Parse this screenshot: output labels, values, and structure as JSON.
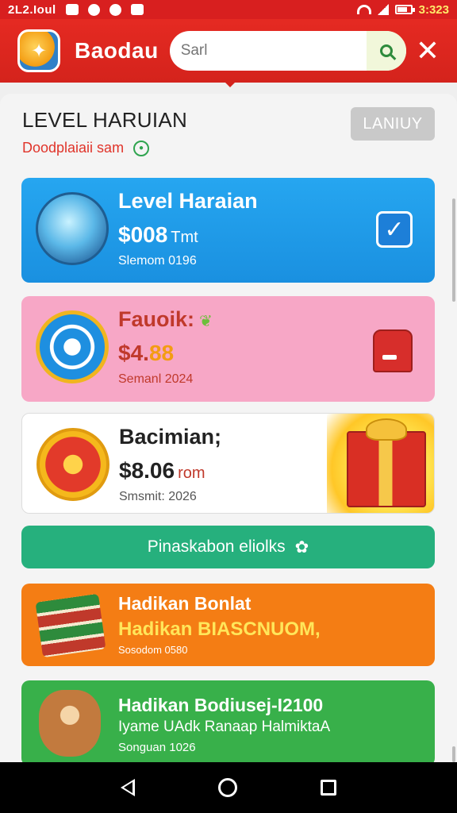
{
  "status_bar": {
    "left_text": "2L2.Ioul",
    "time": "3:323"
  },
  "app_bar": {
    "title": "Baodau",
    "search_placeholder": "Sarl"
  },
  "header": {
    "title": "LEVEL HARUIAN",
    "subtitle": "Doodplaiaii sam",
    "button_label": "LANIUY"
  },
  "cards": [
    {
      "title": "Level Haraian",
      "price": "$008",
      "unit": "Tmt",
      "meta": "Slemom 0196",
      "color": "#1e9be8"
    },
    {
      "title": "Fauoik:",
      "price": "$4.",
      "unit": "88",
      "meta": "Semanl 2024",
      "color": "#f7a7c6"
    },
    {
      "title": "Bacimian;",
      "price": "$8.06",
      "unit": "rom",
      "meta": "Smsmit: 2026",
      "color": "#ffffff"
    }
  ],
  "action_button": {
    "label": "Pinaskabon eliolks"
  },
  "promo_orange": {
    "title": "Hadikan Bonlat",
    "subtitle": "Hadikan BIASCNUOM,",
    "meta": "Sosodom 0580",
    "color": "#f47d14"
  },
  "promo_green": {
    "title": "Hadikan Bodiusej-I2100",
    "subtitle": "Iyame UAdk Ranaap HalmiktaA",
    "meta": "Songuan 1026",
    "color": "#38b04a"
  }
}
